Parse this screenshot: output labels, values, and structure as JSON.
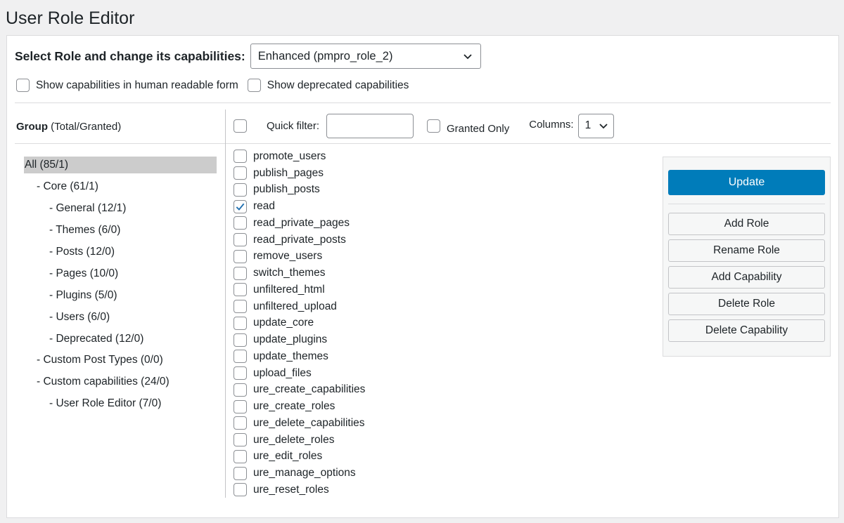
{
  "page": {
    "title": "User Role Editor"
  },
  "role": {
    "label": "Select Role and change its capabilities:",
    "selected": "Enhanced (pmpro_role_2)"
  },
  "options": {
    "human_readable": "Show capabilities in human readable form",
    "deprecated": "Show deprecated capabilities"
  },
  "group_header": {
    "bold": "Group",
    "rest": " (Total/Granted)"
  },
  "filter": {
    "quick_filter_label": "Quick filter:",
    "quick_filter_value": "",
    "granted_only": "Granted Only",
    "columns_label": "Columns:",
    "columns_value": "1"
  },
  "groups": [
    {
      "label": "All (85/1)",
      "level": 0,
      "selected": true
    },
    {
      "label": "- Core (61/1)",
      "level": 1
    },
    {
      "label": "- General (12/1)",
      "level": 2
    },
    {
      "label": "- Themes (6/0)",
      "level": 2
    },
    {
      "label": "- Posts (12/0)",
      "level": 2
    },
    {
      "label": "- Pages (10/0)",
      "level": 2
    },
    {
      "label": "- Plugins (5/0)",
      "level": 2
    },
    {
      "label": "- Users (6/0)",
      "level": 2
    },
    {
      "label": "- Deprecated (12/0)",
      "level": 2
    },
    {
      "label": "- Custom Post Types (0/0)",
      "level": 1
    },
    {
      "label": "- Custom capabilities (24/0)",
      "level": 1
    },
    {
      "label": "- User Role Editor (7/0)",
      "level": 2
    }
  ],
  "capabilities": [
    {
      "name": "promote_users",
      "checked": false
    },
    {
      "name": "publish_pages",
      "checked": false
    },
    {
      "name": "publish_posts",
      "checked": false
    },
    {
      "name": "read",
      "checked": true
    },
    {
      "name": "read_private_pages",
      "checked": false
    },
    {
      "name": "read_private_posts",
      "checked": false
    },
    {
      "name": "remove_users",
      "checked": false
    },
    {
      "name": "switch_themes",
      "checked": false
    },
    {
      "name": "unfiltered_html",
      "checked": false
    },
    {
      "name": "unfiltered_upload",
      "checked": false
    },
    {
      "name": "update_core",
      "checked": false
    },
    {
      "name": "update_plugins",
      "checked": false
    },
    {
      "name": "update_themes",
      "checked": false
    },
    {
      "name": "upload_files",
      "checked": false
    },
    {
      "name": "ure_create_capabilities",
      "checked": false
    },
    {
      "name": "ure_create_roles",
      "checked": false
    },
    {
      "name": "ure_delete_capabilities",
      "checked": false
    },
    {
      "name": "ure_delete_roles",
      "checked": false
    },
    {
      "name": "ure_edit_roles",
      "checked": false
    },
    {
      "name": "ure_manage_options",
      "checked": false
    },
    {
      "name": "ure_reset_roles",
      "checked": false
    }
  ],
  "actions": {
    "update": "Update",
    "add_role": "Add Role",
    "rename_role": "Rename Role",
    "add_capability": "Add Capability",
    "delete_role": "Delete Role",
    "delete_capability": "Delete Capability"
  },
  "colors": {
    "primary": "#007cba",
    "check": "#2271b1",
    "selected_group": "#cccccc"
  },
  "icons": {
    "select_chevron": "chevron-down-icon",
    "check": "checkmark-icon"
  }
}
